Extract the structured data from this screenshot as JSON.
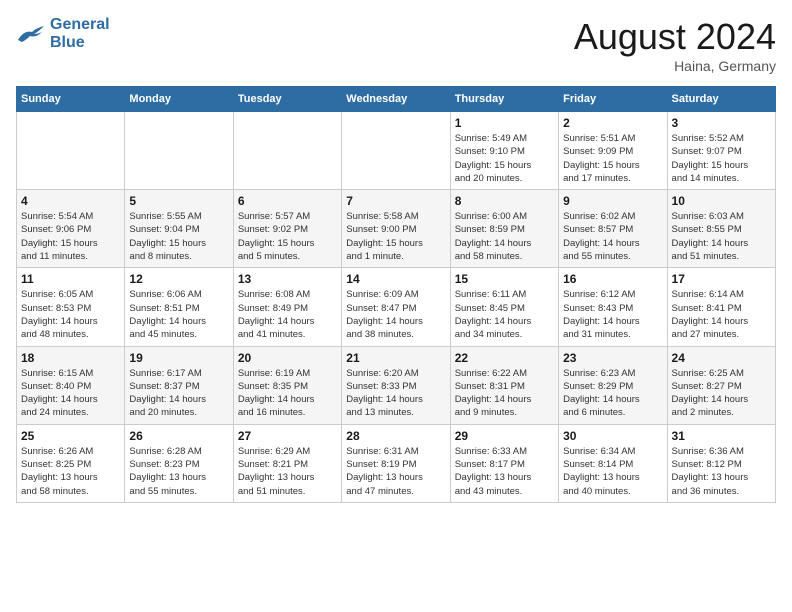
{
  "header": {
    "logo_line1": "General",
    "logo_line2": "Blue",
    "month_year": "August 2024",
    "location": "Haina, Germany"
  },
  "weekdays": [
    "Sunday",
    "Monday",
    "Tuesday",
    "Wednesday",
    "Thursday",
    "Friday",
    "Saturday"
  ],
  "weeks": [
    [
      {
        "num": "",
        "info": ""
      },
      {
        "num": "",
        "info": ""
      },
      {
        "num": "",
        "info": ""
      },
      {
        "num": "",
        "info": ""
      },
      {
        "num": "1",
        "info": "Sunrise: 5:49 AM\nSunset: 9:10 PM\nDaylight: 15 hours\nand 20 minutes."
      },
      {
        "num": "2",
        "info": "Sunrise: 5:51 AM\nSunset: 9:09 PM\nDaylight: 15 hours\nand 17 minutes."
      },
      {
        "num": "3",
        "info": "Sunrise: 5:52 AM\nSunset: 9:07 PM\nDaylight: 15 hours\nand 14 minutes."
      }
    ],
    [
      {
        "num": "4",
        "info": "Sunrise: 5:54 AM\nSunset: 9:06 PM\nDaylight: 15 hours\nand 11 minutes."
      },
      {
        "num": "5",
        "info": "Sunrise: 5:55 AM\nSunset: 9:04 PM\nDaylight: 15 hours\nand 8 minutes."
      },
      {
        "num": "6",
        "info": "Sunrise: 5:57 AM\nSunset: 9:02 PM\nDaylight: 15 hours\nand 5 minutes."
      },
      {
        "num": "7",
        "info": "Sunrise: 5:58 AM\nSunset: 9:00 PM\nDaylight: 15 hours\nand 1 minute."
      },
      {
        "num": "8",
        "info": "Sunrise: 6:00 AM\nSunset: 8:59 PM\nDaylight: 14 hours\nand 58 minutes."
      },
      {
        "num": "9",
        "info": "Sunrise: 6:02 AM\nSunset: 8:57 PM\nDaylight: 14 hours\nand 55 minutes."
      },
      {
        "num": "10",
        "info": "Sunrise: 6:03 AM\nSunset: 8:55 PM\nDaylight: 14 hours\nand 51 minutes."
      }
    ],
    [
      {
        "num": "11",
        "info": "Sunrise: 6:05 AM\nSunset: 8:53 PM\nDaylight: 14 hours\nand 48 minutes."
      },
      {
        "num": "12",
        "info": "Sunrise: 6:06 AM\nSunset: 8:51 PM\nDaylight: 14 hours\nand 45 minutes."
      },
      {
        "num": "13",
        "info": "Sunrise: 6:08 AM\nSunset: 8:49 PM\nDaylight: 14 hours\nand 41 minutes."
      },
      {
        "num": "14",
        "info": "Sunrise: 6:09 AM\nSunset: 8:47 PM\nDaylight: 14 hours\nand 38 minutes."
      },
      {
        "num": "15",
        "info": "Sunrise: 6:11 AM\nSunset: 8:45 PM\nDaylight: 14 hours\nand 34 minutes."
      },
      {
        "num": "16",
        "info": "Sunrise: 6:12 AM\nSunset: 8:43 PM\nDaylight: 14 hours\nand 31 minutes."
      },
      {
        "num": "17",
        "info": "Sunrise: 6:14 AM\nSunset: 8:41 PM\nDaylight: 14 hours\nand 27 minutes."
      }
    ],
    [
      {
        "num": "18",
        "info": "Sunrise: 6:15 AM\nSunset: 8:40 PM\nDaylight: 14 hours\nand 24 minutes."
      },
      {
        "num": "19",
        "info": "Sunrise: 6:17 AM\nSunset: 8:37 PM\nDaylight: 14 hours\nand 20 minutes."
      },
      {
        "num": "20",
        "info": "Sunrise: 6:19 AM\nSunset: 8:35 PM\nDaylight: 14 hours\nand 16 minutes."
      },
      {
        "num": "21",
        "info": "Sunrise: 6:20 AM\nSunset: 8:33 PM\nDaylight: 14 hours\nand 13 minutes."
      },
      {
        "num": "22",
        "info": "Sunrise: 6:22 AM\nSunset: 8:31 PM\nDaylight: 14 hours\nand 9 minutes."
      },
      {
        "num": "23",
        "info": "Sunrise: 6:23 AM\nSunset: 8:29 PM\nDaylight: 14 hours\nand 6 minutes."
      },
      {
        "num": "24",
        "info": "Sunrise: 6:25 AM\nSunset: 8:27 PM\nDaylight: 14 hours\nand 2 minutes."
      }
    ],
    [
      {
        "num": "25",
        "info": "Sunrise: 6:26 AM\nSunset: 8:25 PM\nDaylight: 13 hours\nand 58 minutes."
      },
      {
        "num": "26",
        "info": "Sunrise: 6:28 AM\nSunset: 8:23 PM\nDaylight: 13 hours\nand 55 minutes."
      },
      {
        "num": "27",
        "info": "Sunrise: 6:29 AM\nSunset: 8:21 PM\nDaylight: 13 hours\nand 51 minutes."
      },
      {
        "num": "28",
        "info": "Sunrise: 6:31 AM\nSunset: 8:19 PM\nDaylight: 13 hours\nand 47 minutes."
      },
      {
        "num": "29",
        "info": "Sunrise: 6:33 AM\nSunset: 8:17 PM\nDaylight: 13 hours\nand 43 minutes."
      },
      {
        "num": "30",
        "info": "Sunrise: 6:34 AM\nSunset: 8:14 PM\nDaylight: 13 hours\nand 40 minutes."
      },
      {
        "num": "31",
        "info": "Sunrise: 6:36 AM\nSunset: 8:12 PM\nDaylight: 13 hours\nand 36 minutes."
      }
    ]
  ]
}
